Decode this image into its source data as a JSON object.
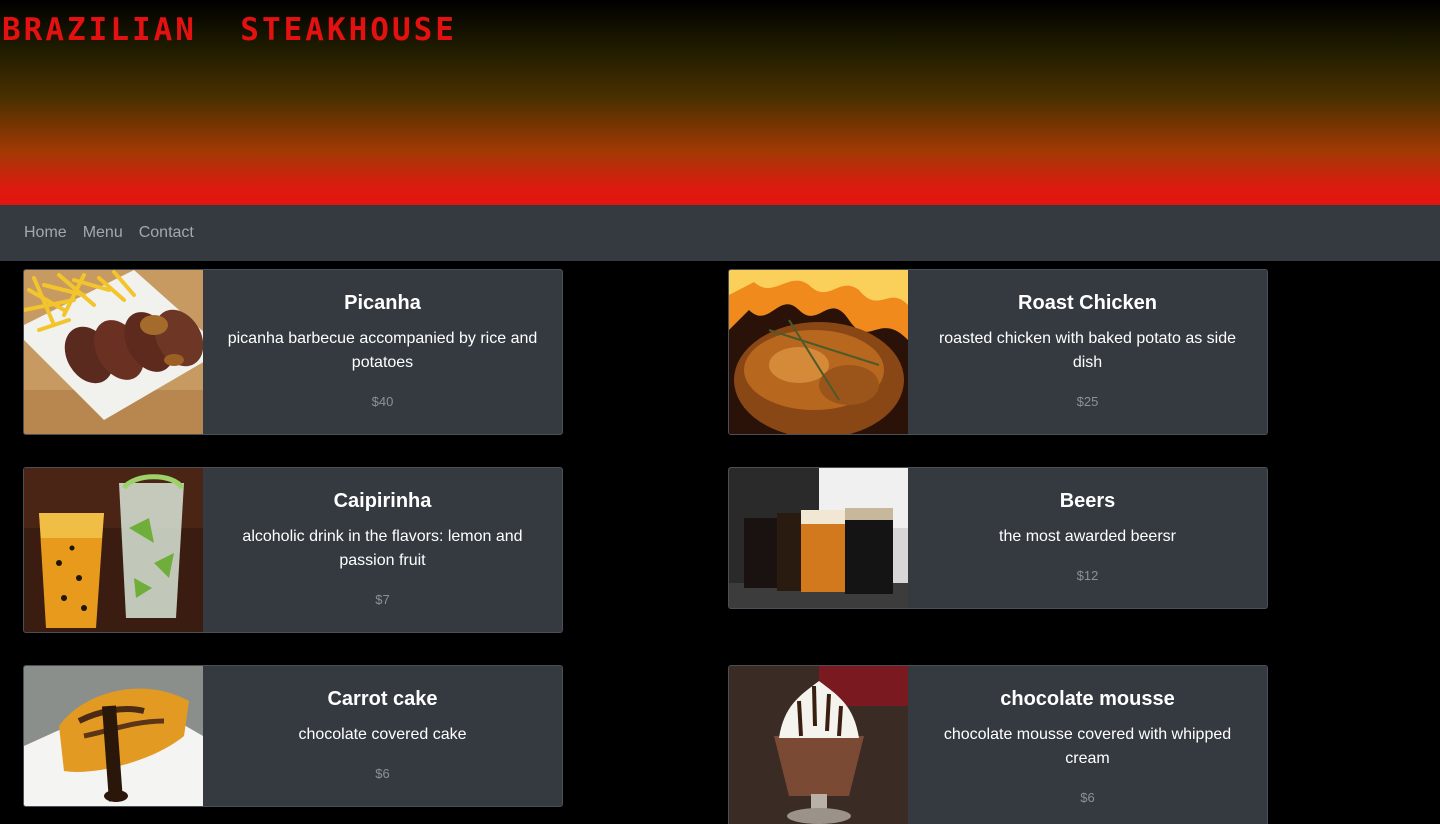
{
  "header": {
    "title": "BRAZILIAN  STEAKHOUSE"
  },
  "nav": {
    "home": "Home",
    "menu": "Menu",
    "contact": "Contact"
  },
  "menu": [
    {
      "title": "Picanha",
      "description": "picanha barbecue accompanied by rice and potatoes",
      "price": "$40",
      "image": "picanha-photo"
    },
    {
      "title": "Roast Chicken",
      "description": "roasted chicken with baked potato as side dish",
      "price": "$25",
      "image": "roast-chicken-photo"
    },
    {
      "title": "Caipirinha",
      "description": "alcoholic drink in the flavors: lemon and passion fruit",
      "price": "$7",
      "image": "caipirinha-photo"
    },
    {
      "title": "Beers",
      "description": "the most awarded beersr",
      "price": "$12",
      "image": "beers-photo"
    },
    {
      "title": "Carrot cake",
      "description": "chocolate covered cake",
      "price": "$6",
      "image": "carrot-cake-photo"
    },
    {
      "title": "chocolate mousse",
      "description": "chocolate mousse covered with whipped cream",
      "price": "$6",
      "image": "chocolate-mousse-photo"
    }
  ],
  "colors": {
    "brand": "#e3110f",
    "navbar": "#343a40",
    "card": "#343a40",
    "price": "#8b9197"
  }
}
